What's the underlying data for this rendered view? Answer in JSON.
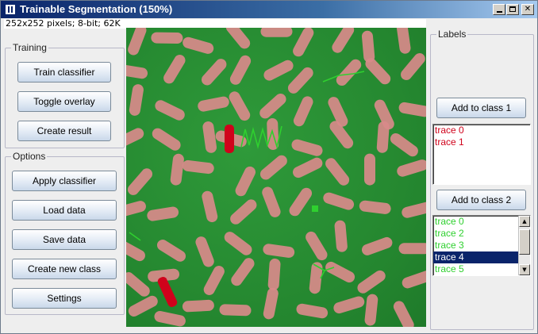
{
  "window": {
    "title": "Trainable Segmentation (150%)",
    "status": "252x252 pixels; 8-bit; 62K"
  },
  "training": {
    "title": "Training",
    "buttons": [
      "Train classifier",
      "Toggle overlay",
      "Create result"
    ]
  },
  "options": {
    "title": "Options",
    "buttons": [
      "Apply classifier",
      "Load data",
      "Save data",
      "Create new class",
      "Settings"
    ]
  },
  "labels": {
    "title": "Labels",
    "class1_button": "Add to class 1",
    "class2_button": "Add to class 2",
    "class1_items": [
      "trace 0",
      "trace 1"
    ],
    "class2_items": [
      "trace 0",
      "trace 2",
      "trace 3",
      "trace 4",
      "trace 5"
    ],
    "class2_selected": "trace 4"
  },
  "colors": {
    "class1": "#d0021b",
    "class2": "#2fd02f",
    "background_overlay": "#27902f",
    "grain_overlay": "#d88a8a",
    "selection": "#0a246a"
  }
}
